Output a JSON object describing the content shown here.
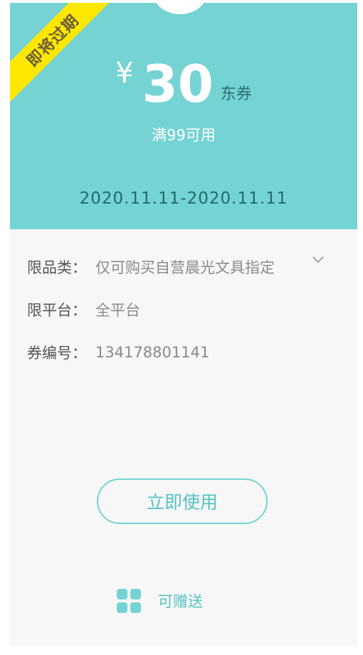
{
  "badge": {
    "label": "即将过期"
  },
  "coupon": {
    "currency": "¥",
    "amount": "30",
    "unit": "东券",
    "condition": "满99可用",
    "validity": "2020.11.11-2020.11.11"
  },
  "details": [
    {
      "label": "限品类：",
      "value": "仅可购买自营晨光文具指定"
    },
    {
      "label": "限平台：",
      "value": "全平台"
    },
    {
      "label": "券编号：",
      "value": "134178801141"
    }
  ],
  "actions": {
    "use_label": "立即使用",
    "gift_label": "可赠送",
    "gift_icon": "grid-icon",
    "expand_icon": "chevron-down-icon"
  },
  "colors": {
    "accent": "#75d3d3",
    "badge": "#ffe800",
    "background": "#f7f7f7"
  }
}
